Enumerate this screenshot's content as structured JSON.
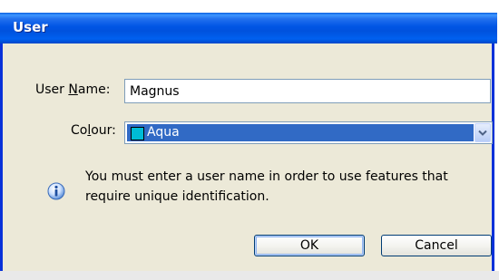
{
  "window": {
    "title": "User"
  },
  "form": {
    "username_label_prefix": "User ",
    "username_label_mnemonic": "N",
    "username_label_suffix": "ame:",
    "username_value": "Magnus",
    "colour_label_prefix": "Co",
    "colour_label_mnemonic": "l",
    "colour_label_suffix": "our:",
    "colour_value": "Aqua",
    "colour_swatch": "#00bcd6",
    "colour_dropdown_icon": "chevron-down-icon"
  },
  "info": {
    "icon": "info-icon",
    "message": "You must enter a user name in order to use features that require unique identification."
  },
  "buttons": {
    "ok": "OK",
    "cancel": "Cancel"
  },
  "colors": {
    "titlebar": "#0055e5",
    "dialog_background": "#ece9d8",
    "selection": "#316ac5"
  }
}
